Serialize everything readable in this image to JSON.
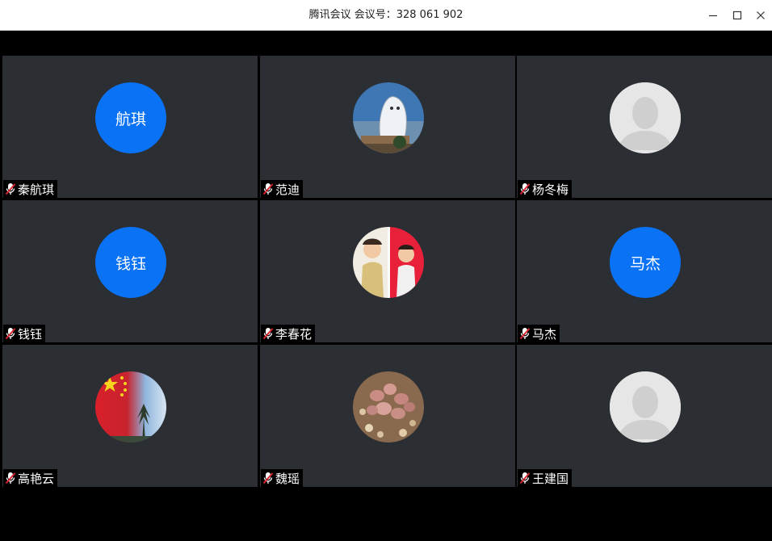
{
  "window": {
    "title": "腾讯会议 会议号：328 061 902",
    "buttons": {
      "minimize": "minimize-icon",
      "maximize": "maximize-icon",
      "close": "close-icon"
    }
  },
  "colors": {
    "titlebar_bg": "#ffffff",
    "stage_bg": "#000000",
    "tile_bg": "#2b2e33",
    "avatar_blue": "#0a72f5",
    "muted_mic": "#d9232d"
  },
  "participants": [
    {
      "name": "秦航琪",
      "avatar_type": "text",
      "avatar_text": "航琪",
      "mic": "muted-mic-icon"
    },
    {
      "name": "范迪",
      "avatar_type": "photo",
      "avatar_text": "",
      "mic": "muted-mic-icon"
    },
    {
      "name": "杨冬梅",
      "avatar_type": "default",
      "avatar_text": "",
      "mic": "muted-mic-icon"
    },
    {
      "name": "钱钰",
      "avatar_type": "text",
      "avatar_text": "钱钰",
      "mic": "muted-mic-icon"
    },
    {
      "name": "李春花",
      "avatar_type": "photo",
      "avatar_text": "",
      "mic": "muted-mic-icon"
    },
    {
      "name": "马杰",
      "avatar_type": "text",
      "avatar_text": "马杰",
      "mic": "muted-mic-icon"
    },
    {
      "name": "高艳云",
      "avatar_type": "photo",
      "avatar_text": "",
      "mic": "muted-mic-icon"
    },
    {
      "name": "魏瑶",
      "avatar_type": "photo",
      "avatar_text": "",
      "mic": "muted-mic-icon"
    },
    {
      "name": "王建国",
      "avatar_type": "default",
      "avatar_text": "",
      "mic": "muted-mic-icon"
    }
  ]
}
